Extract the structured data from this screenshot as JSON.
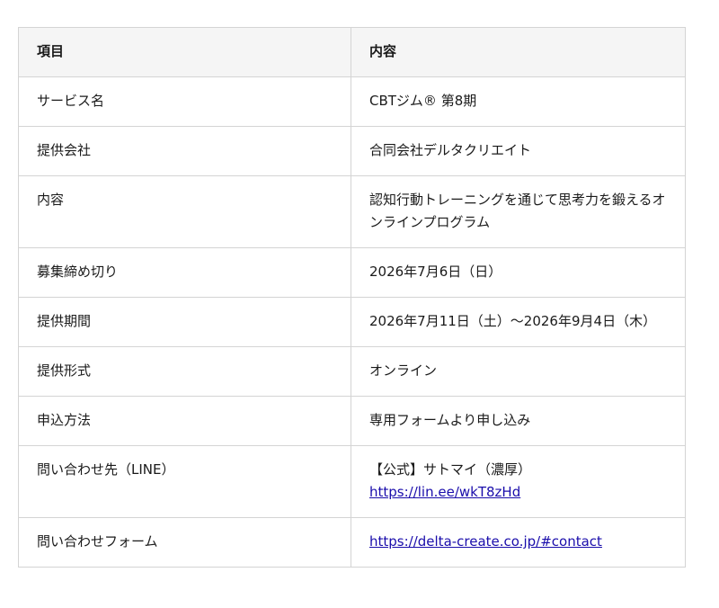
{
  "table": {
    "headers": [
      "項目",
      "内容"
    ],
    "rows": [
      {
        "label": "サービス名",
        "value": "CBTジム® 第8期"
      },
      {
        "label": "提供会社",
        "value": "合同会社デルタクリエイト"
      },
      {
        "label": "内容",
        "value": "認知行動トレーニングを通じて思考力を鍛えるオンラインプログラム"
      },
      {
        "label": "募集締め切り",
        "value": "2026年7月6日（日）"
      },
      {
        "label": "提供期間",
        "value": "2026年7月11日（土）〜2026年9月4日（木）"
      },
      {
        "label": "提供形式",
        "value": "オンライン"
      },
      {
        "label": "申込方法",
        "value": "専用フォームより申し込み"
      },
      {
        "label": "問い合わせ先（LINE）",
        "value": "【公式】サトマイ（濃厚）",
        "link": "https://lin.ee/wkT8zHd"
      },
      {
        "label": "問い合わせフォーム",
        "link": "https://delta-create.co.jp/#contact"
      }
    ]
  }
}
